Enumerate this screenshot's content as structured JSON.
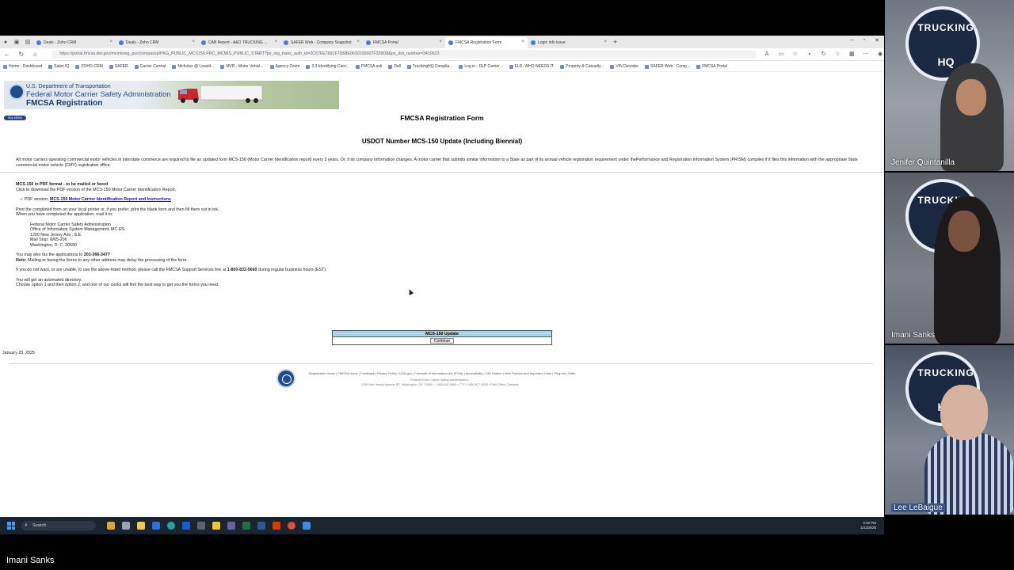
{
  "browser": {
    "tabs": [
      {
        "label": "Deals - Zoho CRM",
        "active": false
      },
      {
        "label": "Deals - Zoho CRM",
        "active": false
      },
      {
        "label": "CAB Report - A&O TRUCKING ...",
        "active": false
      },
      {
        "label": "SAFER Web - Company Snapshot",
        "active": false
      },
      {
        "label": "FMCSA Portal",
        "active": false
      },
      {
        "label": "FMCSA Registration Form",
        "active": true
      },
      {
        "label": "Login info issue",
        "active": false
      }
    ],
    "new_tab": "+",
    "window_controls": [
      "–",
      "▫",
      "✕"
    ],
    "url": "https://portal.fmcsa.dot.gov/mcmisreg_puc/compassp/PKG_PUBLIC_MCS150.PRC_MCMIS_PUBLIC_START?pv_reg_trans_auth_id=2C67FE7691F7D68E0630100007F339D8&pn_dot_number=3410623",
    "bookmarks": [
      "Home - Dashboard",
      "Sales IQ",
      "ZOHO-CRM",
      "SAFER",
      "Carrier Central",
      "Nicholas @ Leavitt...",
      "MVR - Motor Vehicl...",
      "Agency Zoom",
      "3.3 Identifying Carri...",
      "FMCSA ask",
      "Dell",
      "TruckingHQ Complia...",
      "Log in - DLP Carrier...",
      "ELD- WHO NEEDS IT",
      "Property & Casualty...",
      "VIN Decoder",
      "SAFER Web - Comp...",
      "FMCSA Portal"
    ]
  },
  "page": {
    "banner": {
      "line1": "U.S. Department of Transportation",
      "line2": "Federal Motor Carrier Safety Administration",
      "line3": "FMCSA Registration"
    },
    "skip_link": "Skip MENU",
    "title": "FMCSA Registration Form",
    "subtitle": "USDOT Number MCS-150 Update (Including Biennial)",
    "intro": "All motor carriers operating commercial motor vehicles in interstate commerce are required to file an updated form MCS-150 (Motor Carrier Identification report) every 2 years. Or, if its company information changes. A motor carrier that submits similar information to a State as part of its annual vehicle registration requirement under thePerformance and Registration Information System (PRISM) complies if it files this information with the appropriate State commercial motor vehicle (CMV) registration office.",
    "pdf_heading": "MCS-150 in PDF format - to be mailed or faxed",
    "pdf_instruction": "Click to download the PDF version of the MCS-150 Motor Carrier Identification Report.",
    "pdf_label": "PDF version:",
    "pdf_link": "MCS-150 Motor Carrier Identification Report and Instructions",
    "print_line1": "Print the completed form on your local printer or, if you prefer, print the blank form and then fill them out in ink.",
    "print_line2": "When you have completed the application, mail it to:",
    "address": [
      "Federal Motor Carrier Safety Administration",
      "Office of Information System Management, MC-RS",
      "1200 New Jersey Ave., S.E.",
      "Mail Stop: W65-206",
      "Washington, D. C. 20590"
    ],
    "fax_prefix": "You may also fax the applications to",
    "fax_number": "202-366-3477",
    "note_label": "Note:",
    "note_text": "Mailing or faxing the forms to any other address may delay the processing of the form.",
    "support_prefix": "If you do not want, or are unable, to use the above-listed method, please call the FMCSA Support Services line at",
    "support_number": "1-800-832-5660",
    "support_suffix": "during regular business hours (EST).",
    "auto_line1": "You will get an automated directory.",
    "auto_line2": "Choose option 1 and then option 2, and one of our clerks will find the best way to get you the forms you need.",
    "update_box_title": "MCS-150 Update",
    "continue_label": "Continue",
    "date": "January 23, 2025",
    "footer_links": "Registration Home | FMCSA Home | Feedback | Privacy Policy | USA.gov | Freedom of Information Act (FOIA) | Accessibility | OIG Hotline | Web Policies and Important Links | Plug-ins | Safer",
    "footer_org": "Federal Motor Carrier Safety Administration",
    "footer_addr": "1200 New Jersey Avenue SE, Washington, DC 20590 • 1-800-832-5660 • TTY: 1-800-877-8339 • Field Office Contacts"
  },
  "taskbar": {
    "search_placeholder": "Search",
    "time": "3:32 PM",
    "date": "1/23/2025"
  },
  "participants": [
    {
      "name": "Jenifer Quintanilla"
    },
    {
      "name": "Imani Sanks"
    },
    {
      "name": "Lee LeBaigue"
    }
  ],
  "wall_logo": {
    "top": "TRUCKING",
    "bottom": "HQ"
  },
  "active_speaker": "Imani Sanks"
}
